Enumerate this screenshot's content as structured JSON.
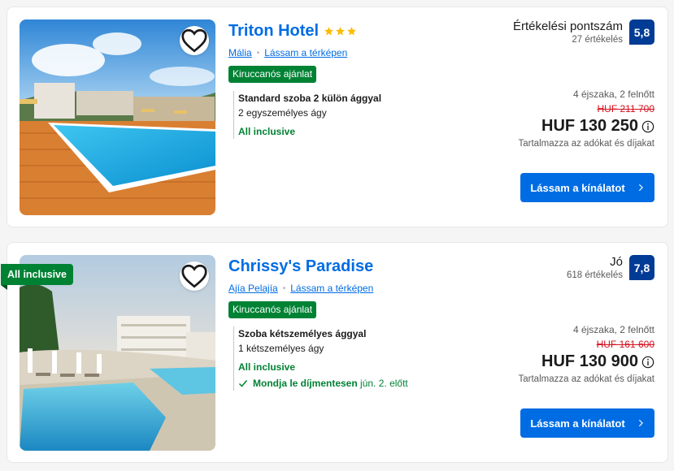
{
  "listings": [
    {
      "name": "Triton Hotel",
      "stars": 3,
      "location": "Mália",
      "map_link": "Lássam a térképen",
      "deal_badge": "Kiruccanós ajánlat",
      "room_name": "Standard szoba 2 külön ággyal",
      "room_beds": "2 egyszemélyes ágy",
      "inclusion": "All inclusive",
      "score_label": "Értékelési pontszám",
      "review_count": "27 értékelés",
      "score": "5,8",
      "nights": "4 éjszaka, 2 felnőtt",
      "old_price": "HUF 211 700",
      "price": "HUF 130 250",
      "taxes": "Tartalmazza az adókat és díjakat",
      "cta": "Lássam a kínálatot",
      "favorite_icon": "heart-icon",
      "info_icon": "info-circle-icon"
    },
    {
      "name": "Chrissy's Paradise",
      "ribbon": "All inclusive",
      "location": "Ajía Pelajía",
      "map_link": "Lássam a térképen",
      "deal_badge": "Kiruccanós ajánlat",
      "room_name": "Szoba kétszemélyes ággyal",
      "room_beds": "1 kétszemélyes ágy",
      "inclusion": "All inclusive",
      "cancel_strong": "Mondja le díjmentesen",
      "cancel_rest": "jún. 2. előtt",
      "score_label": "Jó",
      "review_count": "618 értékelés",
      "score": "7,8",
      "nights": "4 éjszaka, 2 felnőtt",
      "old_price": "HUF 161 600",
      "price": "HUF 130 900",
      "taxes": "Tartalmazza az adókat és díjakat",
      "cta": "Lássam a kínálatot",
      "favorite_icon": "heart-icon",
      "info_icon": "info-circle-icon"
    }
  ],
  "colors": {
    "brand_blue": "#006ce4",
    "score_badge": "#003b95",
    "deal_green": "#008234",
    "old_price_red": "#d4111e",
    "star_yellow": "#febb02"
  }
}
